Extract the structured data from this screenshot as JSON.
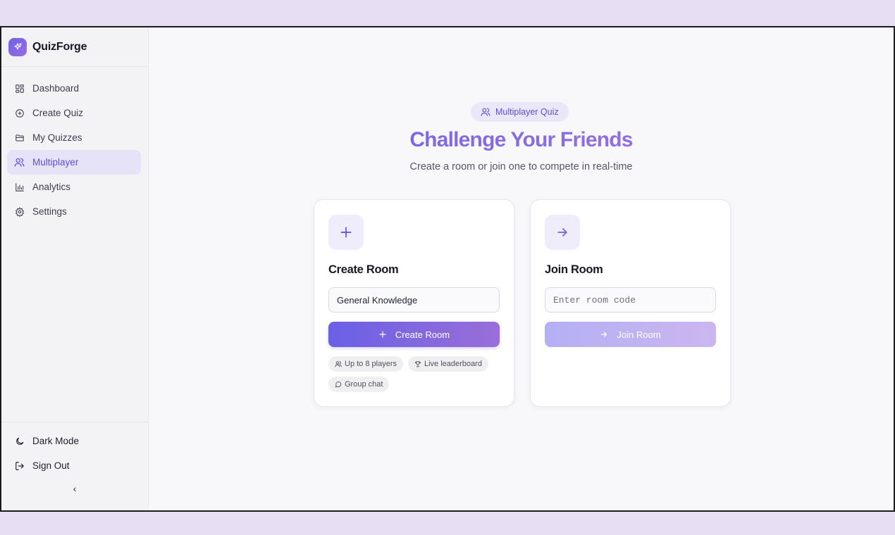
{
  "app": {
    "name": "QuizForge"
  },
  "sidebar": {
    "items": [
      {
        "label": "Dashboard",
        "icon": "dashboard-icon"
      },
      {
        "label": "Create Quiz",
        "icon": "plus-circle-icon"
      },
      {
        "label": "My Quizzes",
        "icon": "folder-icon"
      },
      {
        "label": "Multiplayer",
        "icon": "users-icon",
        "active": true
      },
      {
        "label": "Analytics",
        "icon": "bar-chart-icon"
      },
      {
        "label": "Settings",
        "icon": "gear-icon"
      }
    ],
    "bottom": {
      "dark_mode_label": "Dark Mode",
      "sign_out_label": "Sign Out",
      "collapse_glyph": "‹"
    }
  },
  "main": {
    "pill_label": "Multiplayer Quiz",
    "headline": "Challenge Your Friends",
    "subhead": "Create a room or join one to compete in real-time",
    "create_card": {
      "title": "Create Room",
      "input_value": "General Knowledge",
      "button_label": "Create Room",
      "tags": [
        "Up to 8 players",
        "Live leaderboard",
        "Group chat"
      ]
    },
    "join_card": {
      "title": "Join Room",
      "input_placeholder": "Enter room code",
      "input_value": "",
      "button_label": "Join Room"
    }
  },
  "colors": {
    "accent": "#6a60e6",
    "accent_end": "#9a6ed8",
    "page_background": "#e8def4",
    "active_nav_background": "#e6e2f8"
  }
}
